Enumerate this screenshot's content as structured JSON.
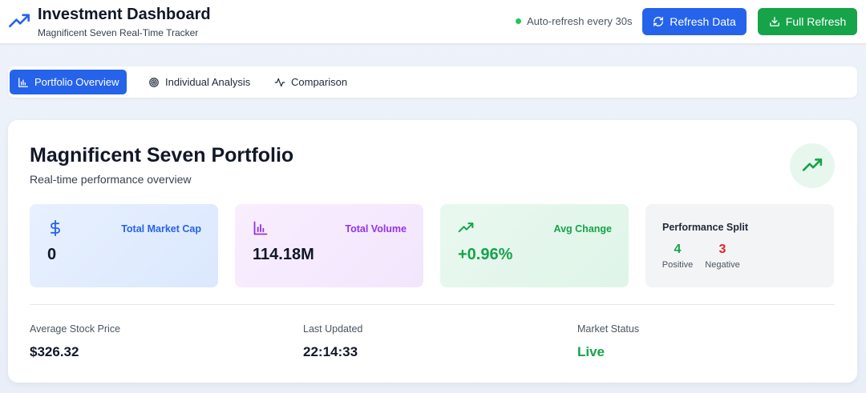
{
  "header": {
    "title": "Investment Dashboard",
    "subtitle": "Magnificent Seven Real-Time Tracker",
    "auto_refresh": "Auto-refresh every 30s",
    "refresh_button": "Refresh Data",
    "full_refresh_button": "Full Refresh",
    "logo_icon": "trending-up-icon",
    "status_color": "#22c55e"
  },
  "tabs": [
    {
      "label": "Portfolio Overview",
      "icon": "bar-chart-icon",
      "active": true
    },
    {
      "label": "Individual Analysis",
      "icon": "target-icon",
      "active": false
    },
    {
      "label": "Comparison",
      "icon": "activity-icon",
      "active": false
    }
  ],
  "portfolio": {
    "title": "Magnificent Seven Portfolio",
    "subtitle": "Real-time performance overview",
    "stats": {
      "market_cap": {
        "label": "Total Market Cap",
        "value": "0",
        "icon": "dollar-icon",
        "color": "#2563eb"
      },
      "volume": {
        "label": "Total Volume",
        "value": "114.18M",
        "icon": "bar-chart-icon",
        "color": "#9333ea"
      },
      "avg_change": {
        "label": "Avg Change",
        "value": "+0.96%",
        "icon": "trending-up-icon",
        "color": "#16a34a"
      },
      "split": {
        "title": "Performance Split",
        "positive": "4",
        "positive_label": "Positive",
        "negative": "3",
        "negative_label": "Negative"
      }
    },
    "footer": {
      "avg_price_label": "Average Stock Price",
      "avg_price": "$326.32",
      "updated_label": "Last Updated",
      "updated": "22:14:33",
      "status_label": "Market Status",
      "status": "Live"
    }
  },
  "colors": {
    "primary": "#2563eb",
    "success": "#16a34a",
    "danger": "#dc2626"
  }
}
